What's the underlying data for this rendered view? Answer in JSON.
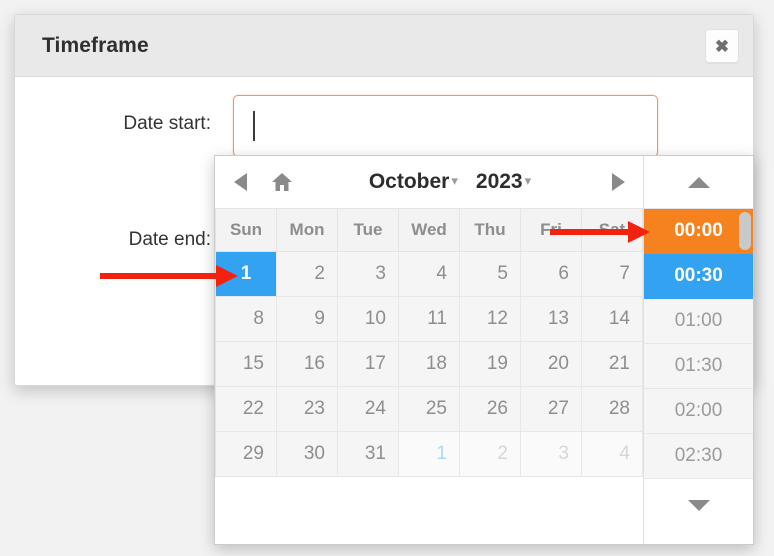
{
  "dialog": {
    "title": "Timeframe",
    "close_icon": "close-icon",
    "close_glyph": "✖",
    "fields": [
      {
        "label": "Date start:",
        "value": "",
        "placeholder": "",
        "focused": true
      },
      {
        "label": "Date end:",
        "value": "",
        "placeholder": "",
        "focused": false
      }
    ]
  },
  "datepicker": {
    "nav": {
      "prev_icon": "triangle-left-icon",
      "home_icon": "home-icon",
      "month": "October",
      "year": "2023",
      "caret": "▾",
      "next_icon": "triangle-right-icon",
      "time_up_icon": "triangle-up-icon",
      "time_down_icon": "triangle-down-icon"
    },
    "day_headers": [
      "Sun",
      "Mon",
      "Tue",
      "Wed",
      "Thu",
      "Fri",
      "Sat"
    ],
    "weeks": [
      [
        {
          "day": "1",
          "state": "selected"
        },
        {
          "day": "2",
          "state": "current"
        },
        {
          "day": "3",
          "state": "current"
        },
        {
          "day": "4",
          "state": "current"
        },
        {
          "day": "5",
          "state": "current"
        },
        {
          "day": "6",
          "state": "current"
        },
        {
          "day": "7",
          "state": "current"
        }
      ],
      [
        {
          "day": "8",
          "state": "current"
        },
        {
          "day": "9",
          "state": "current"
        },
        {
          "day": "10",
          "state": "current"
        },
        {
          "day": "11",
          "state": "current"
        },
        {
          "day": "12",
          "state": "current"
        },
        {
          "day": "13",
          "state": "current"
        },
        {
          "day": "14",
          "state": "current"
        }
      ],
      [
        {
          "day": "15",
          "state": "current"
        },
        {
          "day": "16",
          "state": "current"
        },
        {
          "day": "17",
          "state": "current"
        },
        {
          "day": "18",
          "state": "current"
        },
        {
          "day": "19",
          "state": "current"
        },
        {
          "day": "20",
          "state": "current"
        },
        {
          "day": "21",
          "state": "current"
        }
      ],
      [
        {
          "day": "22",
          "state": "current"
        },
        {
          "day": "23",
          "state": "current"
        },
        {
          "day": "24",
          "state": "current"
        },
        {
          "day": "25",
          "state": "current"
        },
        {
          "day": "26",
          "state": "current"
        },
        {
          "day": "27",
          "state": "current"
        },
        {
          "day": "28",
          "state": "current"
        }
      ],
      [
        {
          "day": "29",
          "state": "current"
        },
        {
          "day": "30",
          "state": "current"
        },
        {
          "day": "31",
          "state": "current"
        },
        {
          "day": "1",
          "state": "other-today"
        },
        {
          "day": "2",
          "state": "other"
        },
        {
          "day": "3",
          "state": "other"
        },
        {
          "day": "4",
          "state": "other"
        }
      ]
    ],
    "times": [
      {
        "label": "00:00",
        "state": "hover"
      },
      {
        "label": "00:30",
        "state": "selected"
      },
      {
        "label": "01:00",
        "state": "normal"
      },
      {
        "label": "01:30",
        "state": "normal"
      },
      {
        "label": "02:00",
        "state": "normal"
      },
      {
        "label": "02:30",
        "state": "normal"
      }
    ],
    "scrollbar": {
      "name": "time-scrollbar-thumb"
    }
  },
  "annotations": [
    {
      "name": "arrow-to-time-00-00",
      "direction": "right"
    },
    {
      "name": "arrow-to-day-1",
      "direction": "right"
    }
  ],
  "colors": {
    "accent_orange": "#f5821f",
    "accent_blue": "#33a3f1",
    "annotation_red": "#f22211",
    "header_grey": "#e9e9e9",
    "cell_grey": "#f5f5f5",
    "focus_border": "#eb9763"
  }
}
